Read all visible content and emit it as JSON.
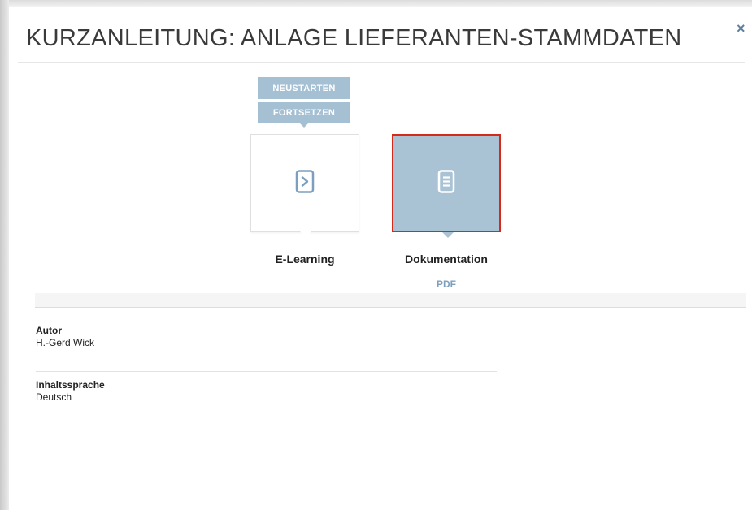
{
  "modal": {
    "title": "KURZANLEITUNG: ANLAGE LIEFERANTEN-STAMMDATEN",
    "close_symbol": "×"
  },
  "actions": {
    "restart_label": "NEUSTARTEN",
    "continue_label": "FORTSETZEN"
  },
  "cards": {
    "elearning": {
      "label": "E-Learning",
      "icon": "chevron-right-icon"
    },
    "documentation": {
      "label": "Dokumentation",
      "icon": "document-icon",
      "format_link": "PDF",
      "selected": true
    }
  },
  "meta": {
    "author_label": "Autor",
    "author_value": "H.-Gerd Wick",
    "language_label": "Inhaltssprache",
    "language_value": "Deutsch"
  },
  "colors": {
    "accent": "#a5bfd3",
    "selected_border": "#d7281c",
    "link": "#7d9fbf"
  }
}
